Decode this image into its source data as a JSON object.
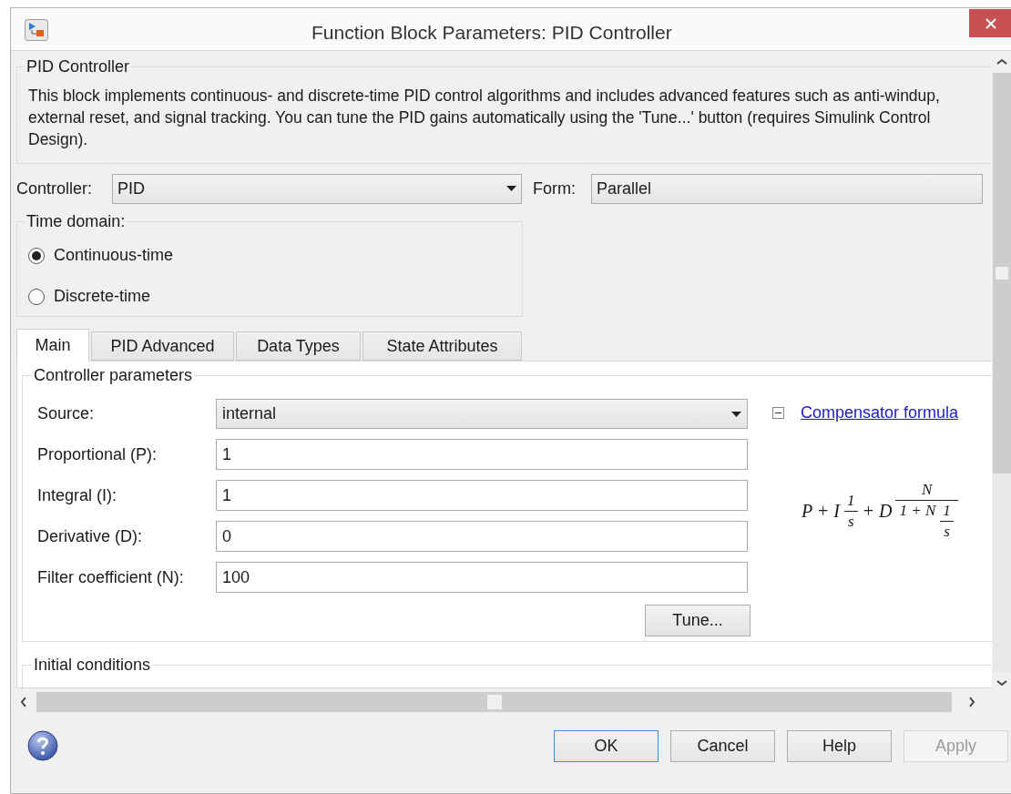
{
  "window": {
    "title": "Function Block Parameters: PID Controller"
  },
  "description": {
    "legend": "PID Controller",
    "text": "This block implements continuous- and discrete-time PID control algorithms and includes advanced features such as anti-windup, external reset, and signal tracking. You can tune the PID gains automatically using the 'Tune...' button (requires Simulink Control Design)."
  },
  "controller": {
    "label": "Controller:",
    "value": "PID"
  },
  "form": {
    "label": "Form:",
    "value": "Parallel"
  },
  "time_domain": {
    "legend": "Time domain:",
    "options": [
      {
        "label": "Continuous-time",
        "selected": true
      },
      {
        "label": "Discrete-time",
        "selected": false
      }
    ]
  },
  "tabs": [
    {
      "label": "Main",
      "selected": true
    },
    {
      "label": "PID Advanced",
      "selected": false
    },
    {
      "label": "Data Types",
      "selected": false
    },
    {
      "label": "State Attributes",
      "selected": false
    }
  ],
  "controller_parameters": {
    "legend": "Controller parameters",
    "rows": [
      {
        "kind": "dropdown",
        "label": "Source:",
        "value": "internal"
      },
      {
        "kind": "field",
        "label": "Proportional (P):",
        "value": "1"
      },
      {
        "kind": "field",
        "label": "Integral (I):",
        "value": "1"
      },
      {
        "kind": "field",
        "label": "Derivative (D):",
        "value": "0"
      },
      {
        "kind": "field",
        "label": "Filter coefficient (N):",
        "value": "100"
      }
    ],
    "tune_button": "Tune...",
    "compensator": {
      "label": "Compensator formula",
      "expanded": true,
      "formula": [
        {
          "kind": "text",
          "text": "P + I"
        },
        {
          "kind": "frac",
          "num": [
            {
              "kind": "text",
              "text": "1"
            }
          ],
          "den": [
            {
              "kind": "text",
              "text": "s"
            }
          ]
        },
        {
          "kind": "text",
          "text": "+ D"
        },
        {
          "kind": "frac",
          "num": [
            {
              "kind": "text",
              "text": "N"
            }
          ],
          "den": [
            {
              "kind": "text",
              "text": "1 + N"
            },
            {
              "kind": "frac",
              "num": [
                {
                  "kind": "text",
                  "text": "1"
                }
              ],
              "den": [
                {
                  "kind": "text",
                  "text": "s"
                }
              ]
            }
          ]
        }
      ]
    }
  },
  "initial_conditions": {
    "legend": "Initial conditions"
  },
  "buttons": [
    {
      "label": "OK",
      "default": true,
      "disabled": false
    },
    {
      "label": "Cancel",
      "default": false,
      "disabled": false
    },
    {
      "label": "Help",
      "default": false,
      "disabled": false
    },
    {
      "label": "Apply",
      "default": false,
      "disabled": true
    }
  ]
}
